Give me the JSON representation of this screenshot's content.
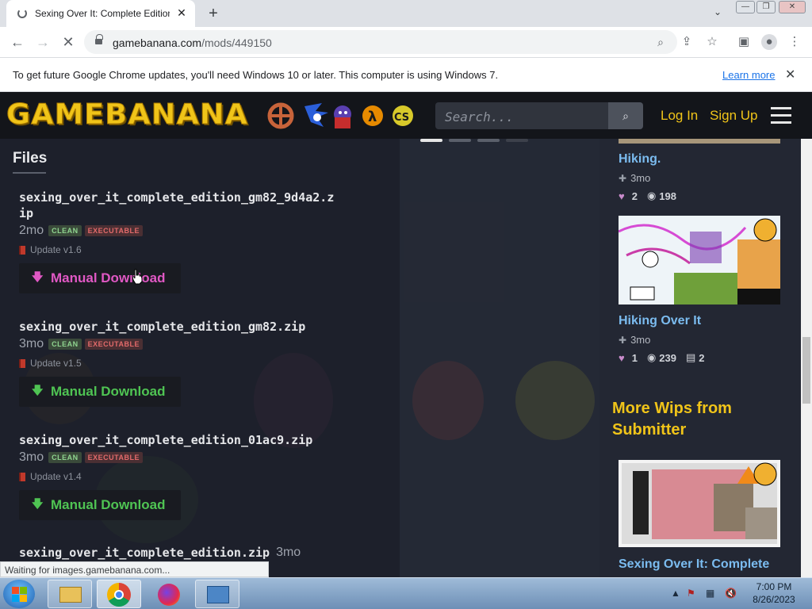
{
  "browser": {
    "tab_title": "Sexing Over It: Complete Edition",
    "url_host": "gamebanana.com",
    "url_path": "/mods/449150",
    "infobar_text": "To get future Google Chrome updates, you'll need Windows 10 or later. This computer is using Windows 7.",
    "infobar_link": "Learn more",
    "status_text": "Waiting for images.gamebanana.com..."
  },
  "site": {
    "logo_text": "GAMEBANANA",
    "search_placeholder": "Search...",
    "login_label": "Log In",
    "signup_label": "Sign Up",
    "accent_color": "#f0c419"
  },
  "files": {
    "heading": "Files",
    "download_label": "Manual Download",
    "items": [
      {
        "name": "sexing_over_it_complete_edition_gm82_9d4a2.zip",
        "age": "2mo",
        "badges": [
          "CLEAN",
          "EXECUTABLE"
        ],
        "update": "Update v1.6"
      },
      {
        "name": "sexing_over_it_complete_edition_gm82.zip",
        "age": "3mo",
        "badges": [
          "CLEAN",
          "EXECUTABLE"
        ],
        "update": "Update v1.5"
      },
      {
        "name": "sexing_over_it_complete_edition_01ac9.zip",
        "age": "3mo",
        "badges": [
          "CLEAN",
          "EXECUTABLE"
        ],
        "update": "Update v1.4"
      },
      {
        "name": "sexing_over_it_complete_edition.zip",
        "age": "3mo"
      }
    ]
  },
  "sidebar": {
    "item1": {
      "title": "Hiking.",
      "age": "3mo",
      "likes": "2",
      "views": "198"
    },
    "item2": {
      "title": "Hiking Over It",
      "age": "3mo",
      "likes": "1",
      "views": "239",
      "comments": "2"
    },
    "more_heading": "More Wips from Submitter",
    "item3": {
      "title": "Sexing Over It: Complete"
    }
  },
  "taskbar": {
    "time": "7:00 PM",
    "date": "8/26/2023"
  }
}
